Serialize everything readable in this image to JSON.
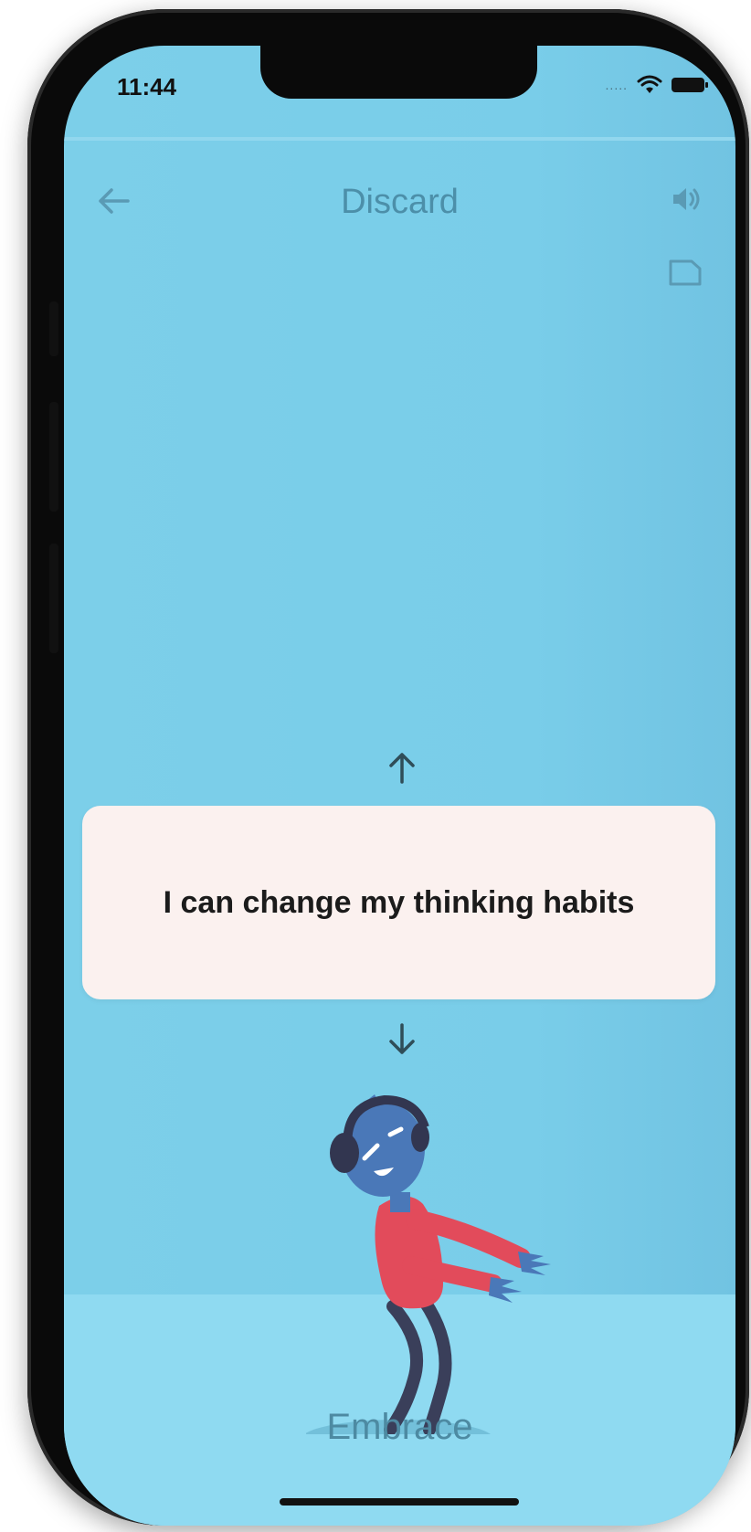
{
  "status_bar": {
    "time": "11:44",
    "signal": "....."
  },
  "header": {
    "title": "Discard"
  },
  "card": {
    "text": "I can change my thinking habits"
  },
  "footer": {
    "label": "Embrace"
  },
  "icons": {
    "back": "arrow-left-icon",
    "sound": "speaker-icon",
    "card": "card-icon",
    "up": "arrow-up-icon",
    "down": "arrow-down-icon"
  },
  "colors": {
    "screen_bg": "#79cde9",
    "card_bg": "#fbf1ef",
    "title_text": "#4c8fa9",
    "figure_shirt": "#e24b5b",
    "figure_head": "#4a78b8"
  }
}
